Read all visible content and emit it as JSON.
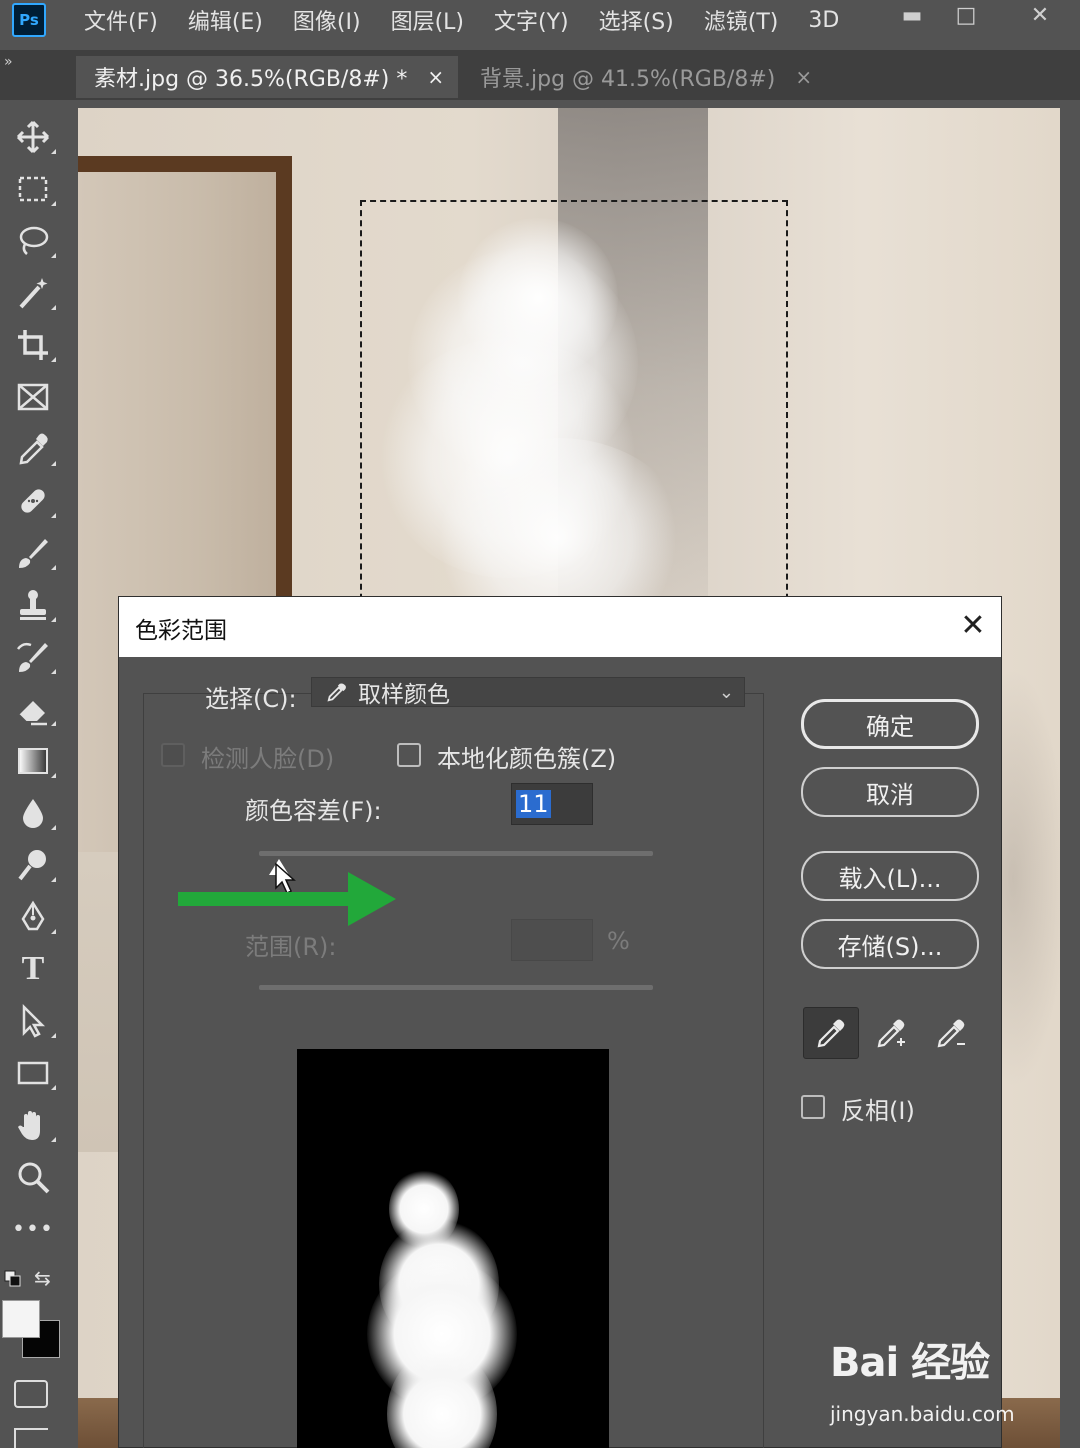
{
  "app": {
    "logo_text": "Ps",
    "menu": [
      "文件(F)",
      "编辑(E)",
      "图像(I)",
      "图层(L)",
      "文字(Y)",
      "选择(S)",
      "滤镜(T)",
      "3D"
    ],
    "window_controls": {
      "minimize": "▬",
      "maximize": "□",
      "close": "✕"
    }
  },
  "tabs": [
    {
      "label": "素材.jpg @ 36.5%(RGB/8#) *",
      "close": "×",
      "active": true
    },
    {
      "label": "背景.jpg @ 41.5%(RGB/8#)",
      "close": "×",
      "active": false
    }
  ],
  "toolbar": {
    "collapse": "»",
    "tools": [
      "move-icon",
      "marquee-rect-icon",
      "lasso-icon",
      "magic-wand-icon",
      "crop-icon",
      "frame-icon",
      "eyedropper-icon",
      "healing-brush-icon",
      "brush-icon",
      "clone-stamp-icon",
      "history-brush-icon",
      "eraser-icon",
      "gradient-icon",
      "blur-icon",
      "dodge-icon",
      "pen-icon",
      "type-icon",
      "path-selection-icon",
      "rectangle-icon",
      "hand-icon",
      "zoom-icon",
      "more-tools-icon"
    ],
    "type_glyph": "T",
    "more_glyph": "•••",
    "swap_glyph": "⇆",
    "foreground_color": "#f4f4f4",
    "background_color": "#050505"
  },
  "dialog": {
    "title": "色彩范围",
    "close": "✕",
    "select_label": "选择(C):",
    "select_value": "取样颜色",
    "select_chevron": "⌄",
    "detect_faces": {
      "label": "检测人脸(D)",
      "checked": false,
      "enabled": false
    },
    "localized_clusters": {
      "label": "本地化颜色簇(Z)",
      "checked": false
    },
    "fuzziness": {
      "label": "颜色容差(F):",
      "value": "11"
    },
    "range": {
      "label": "范围(R):",
      "value": "",
      "unit": "%",
      "enabled": false
    },
    "buttons": {
      "ok": "确定",
      "cancel": "取消",
      "load": "载入(L)...",
      "save": "存储(S)..."
    },
    "eyedroppers": [
      "eyedropper-icon",
      "eyedropper-add-icon",
      "eyedropper-subtract-icon"
    ],
    "invert": {
      "label": "反相(I)",
      "checked": false
    }
  },
  "annotation": {
    "arrow_color": "#22a83a"
  },
  "watermark": {
    "logo": "Bai 经验",
    "url": "jingyan.baidu.com"
  }
}
